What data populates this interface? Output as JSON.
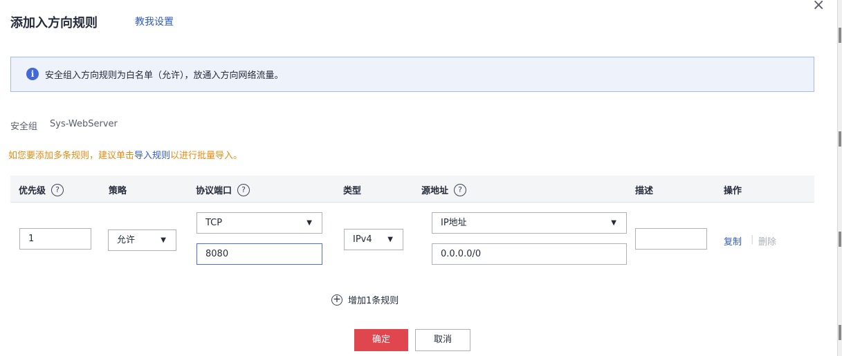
{
  "dialog": {
    "title": "添加入方向规则",
    "help_link": "教我设置",
    "close_icon": "close-icon"
  },
  "info": {
    "icon": "info-icon",
    "icon_glyph": "i",
    "text": "安全组入方向规则为白名单（允许），放通入方向网络流量。"
  },
  "security_group": {
    "label": "安全组",
    "value": "Sys-WebServer"
  },
  "tip": {
    "prefix": "如您要添加多条规则，建议单击",
    "link": "导入规则",
    "suffix": "以进行批量导入。"
  },
  "table": {
    "headers": {
      "priority": "优先级",
      "policy": "策略",
      "protocol_port": "协议端口",
      "type": "类型",
      "source": "源地址",
      "description": "描述",
      "actions": "操作"
    },
    "help_glyph": "?",
    "row": {
      "priority": "1",
      "policy": "允许",
      "protocol": "TCP",
      "port": "8080",
      "type": "IPv4",
      "source_type": "IP地址",
      "source_value": "0.0.0.0/0",
      "description": "",
      "copy": "复制",
      "separator": "|",
      "delete": "删除"
    },
    "dropdown_glyph": "▼"
  },
  "add_rule": {
    "icon": "plus-circle-icon",
    "glyph": "+",
    "label": "增加1条规则"
  },
  "footer": {
    "ok_label": "确定",
    "cancel_label": "取消"
  },
  "colors": {
    "primary_button": "#e0464e",
    "link": "#2f5bb8",
    "tip": "#e58b15",
    "info_bg": "#eef2fb",
    "info_border": "#a5b8e6"
  }
}
